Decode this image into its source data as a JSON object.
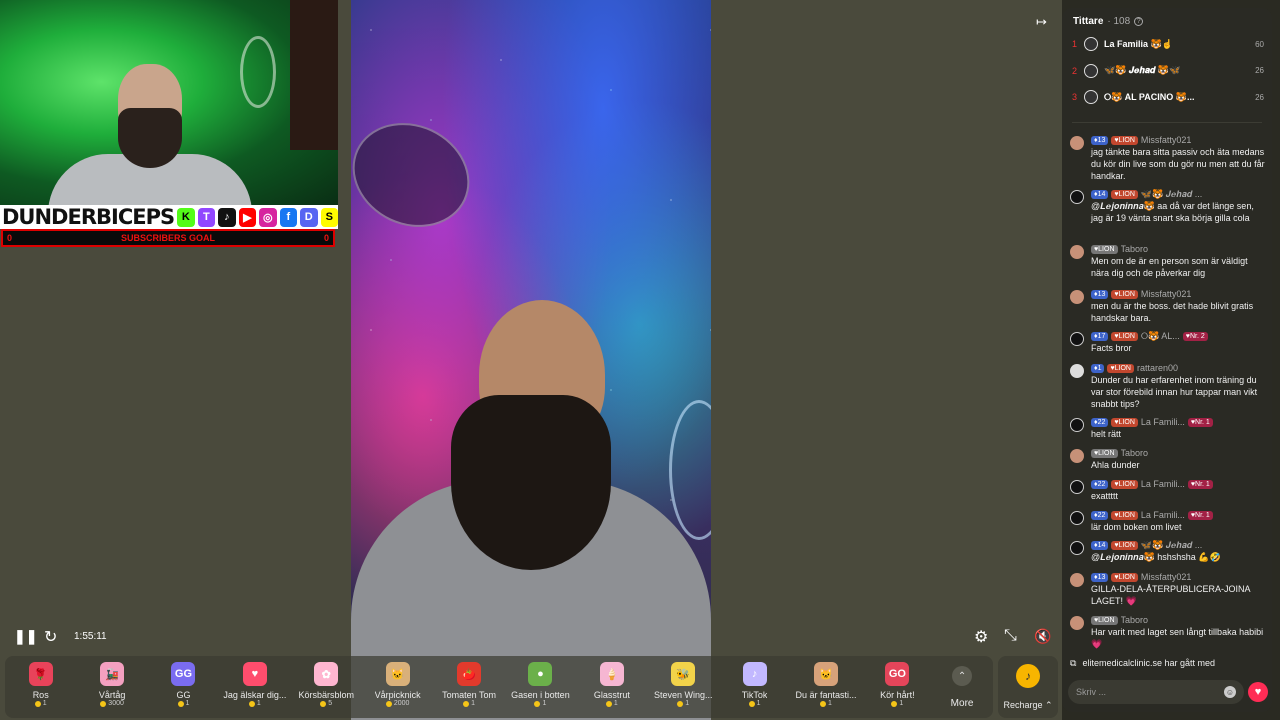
{
  "brand": {
    "name": "DUNDERBICEPS",
    "sub": "SUBSCRIBERS GOAL",
    "socials": [
      "K",
      "T",
      "♪",
      "▶",
      "◎",
      "f",
      "D",
      "S"
    ]
  },
  "player": {
    "time": "1:55:11"
  },
  "gifts": [
    {
      "name": "Ros",
      "price": "1",
      "color": "#e8435a",
      "glyph": "🌹"
    },
    {
      "name": "Vårtåg",
      "price": "3000",
      "color": "#f4a0c0",
      "glyph": "🚂"
    },
    {
      "name": "GG",
      "price": "1",
      "color": "#7a6cf0",
      "glyph": "GG"
    },
    {
      "name": "Jag älskar dig...",
      "price": "1",
      "color": "#ff4d6d",
      "glyph": "♥"
    },
    {
      "name": "Körsbärsblom",
      "price": "5",
      "color": "#ffb6d0",
      "glyph": "✿"
    },
    {
      "name": "Vårpicknick",
      "price": "2000",
      "color": "#d9b07a",
      "glyph": "🐱"
    },
    {
      "name": "Tomaten Tom",
      "price": "1",
      "color": "#e23a2c",
      "glyph": "🍅"
    },
    {
      "name": "Gasen i botten",
      "price": "1",
      "color": "#6bb04a",
      "glyph": "●"
    },
    {
      "name": "Glasstrut",
      "price": "1",
      "color": "#f6b6d2",
      "glyph": "🍦"
    },
    {
      "name": "Steven Wing...",
      "price": "1",
      "color": "#f2d34a",
      "glyph": "🐝"
    },
    {
      "name": "TikTok",
      "price": "1",
      "color": "#c2b8ff",
      "glyph": "♪"
    },
    {
      "name": "Du är fantasti...",
      "price": "1",
      "color": "#d7a27a",
      "glyph": "🐱"
    },
    {
      "name": "Kör hårt!",
      "price": "1",
      "color": "#e4455a",
      "glyph": "GO"
    }
  ],
  "more_label": "More",
  "recharge_label": "Recharge ⌃",
  "viewers": {
    "title": "Tittare",
    "count": "· 108",
    "top": [
      {
        "rank": "1",
        "name": "La Familia 🐯☝",
        "score": "60"
      },
      {
        "rank": "2",
        "name": "🦋🐯 𝑱𝒆𝒉𝒂𝒅 🐯🦋",
        "score": "26"
      },
      {
        "rank": "3",
        "name": "⭘🐯 AL PACINO 🐯...",
        "score": "26"
      }
    ]
  },
  "messages": [
    {
      "lvl": "13",
      "lion": "LION",
      "user": "Missfatty021",
      "nr": "",
      "text": "jag tänkte bara sitta passiv och äta medans du kör din live som du gör nu men att du får handkar.",
      "av": "skin"
    },
    {
      "lvl": "14",
      "lion": "LION",
      "user": "🦋🐯 𝑱𝒆𝒉𝒂𝒅 ...",
      "nr": "",
      "text": "@𝑳𝒆𝒋𝒐𝒏𝒊𝒏𝒏𝒂🐯 aa då var det länge sen, jag är 19 vänta snart ska börja gilla cola",
      "av": "dark"
    },
    {
      "lvl": "",
      "lion": "LION",
      "user": "Taboro",
      "nr": "",
      "text": "Men om de är en person som är väldigt nära dig och de påverkar dig",
      "av": "skin"
    },
    {
      "lvl": "13",
      "lion": "LION",
      "user": "Missfatty021",
      "nr": "",
      "text": "men du är the boss. det hade blivit gratis handskar bara.",
      "av": "skin"
    },
    {
      "lvl": "17",
      "lion": "LION",
      "user": "⭘🐯 AL...",
      "nr": "Nr. 2",
      "text": "Facts bror",
      "av": "dark"
    },
    {
      "lvl": "1",
      "lion": "LION",
      "user": "rattaren00",
      "nr": "",
      "text": "Dunder du har erfarenhet inom träning du var stor förebild innan hur tappar man vikt snabbt tips?",
      "av": "grey"
    },
    {
      "lvl": "22",
      "lion": "LION",
      "user": "La Famili...",
      "nr": "Nr. 1",
      "text": "helt rätt",
      "av": "dark"
    },
    {
      "lvl": "",
      "lion": "LION",
      "user": "Taboro",
      "nr": "",
      "text": "Ahla dunder",
      "av": "skin"
    },
    {
      "lvl": "22",
      "lion": "LION",
      "user": "La Famili...",
      "nr": "Nr. 1",
      "text": "exattttt",
      "av": "dark"
    },
    {
      "lvl": "22",
      "lion": "LION",
      "user": "La Famili...",
      "nr": "Nr. 1",
      "text": "lär dom boken om livet",
      "av": "dark"
    },
    {
      "lvl": "14",
      "lion": "LION",
      "user": "🦋🐯 𝑱𝒆𝒉𝒂𝒅 ...",
      "nr": "",
      "text": "@𝑳𝒆𝒋𝒐𝒏𝒊𝒏𝒏𝒂🐯 hshshsha 💪🤣",
      "av": "dark"
    },
    {
      "lvl": "13",
      "lion": "LION",
      "user": "Missfatty021",
      "nr": "",
      "text": "GILLA-DELA-ÅTERPUBLICERA-JOINA LAGET! 💗",
      "av": "skin"
    },
    {
      "lvl": "",
      "lion": "LION",
      "user": "Taboro",
      "nr": "",
      "text": "Har varit med laget sen långt tillbaka habibi 💗",
      "av": "skin"
    }
  ],
  "system": {
    "text": "elitemedicalclinic.se  har gått med"
  },
  "composer": {
    "placeholder": "Skriv ..."
  }
}
